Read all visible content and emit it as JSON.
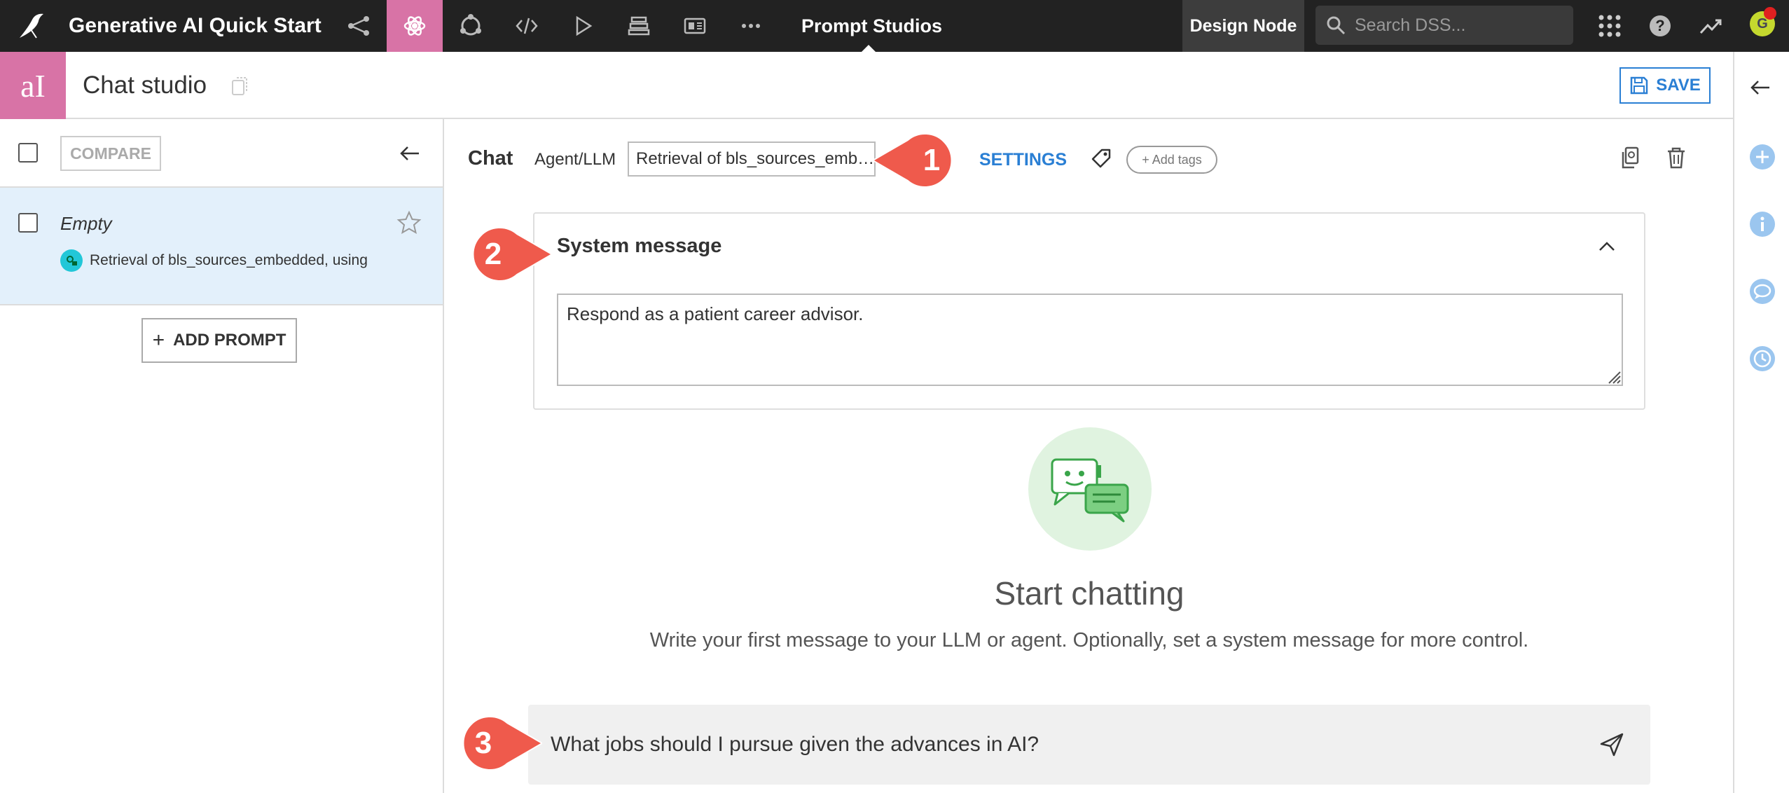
{
  "topnav": {
    "project_title": "Generative AI Quick Start",
    "current_section": "Prompt Studios",
    "design_node": "Design Node",
    "search_placeholder": "Search DSS...",
    "avatar_initial": "G",
    "help_glyph": "?"
  },
  "subheader": {
    "app_badge": "aI",
    "studio_title": "Chat studio",
    "save_label": "SAVE"
  },
  "left_panel": {
    "compare_label": "COMPARE",
    "prompts": [
      {
        "name": "Empty",
        "model": "Retrieval of bls_sources_embedded, using"
      }
    ],
    "add_prompt_label": "ADD PROMPT",
    "add_prompt_glyph": "+"
  },
  "main": {
    "chat_label": "Chat",
    "agent_label": "Agent/LLM",
    "agent_value": "Retrieval of bls_sources_emb…",
    "settings_label": "SETTINGS",
    "add_tags_label": "+ Add tags",
    "system_message": {
      "title": "System message",
      "value": "Respond as a patient career advisor."
    },
    "empty_state": {
      "title": "Start chatting",
      "subtitle": "Write your first message to your LLM or agent. Optionally, set a system message for more control."
    },
    "chat_input_value": "What jobs should I pursue given the advances in AI?"
  },
  "annotations": [
    "1",
    "2",
    "3"
  ],
  "colors": {
    "nav_bg": "#222222",
    "accent_pink": "#d873a6",
    "link_blue": "#2a7fd4",
    "callout_red": "#ef5a4c",
    "selected_row": "#e3f0fb"
  },
  "icons": {
    "nav": [
      "flow-icon",
      "lab-icon",
      "ml-icon",
      "code-icon",
      "run-icon",
      "stack-icon",
      "dashboard-icon",
      "more-icon"
    ],
    "right_rail": [
      "back-arrow-icon",
      "add-icon",
      "info-icon",
      "chat-icon",
      "history-icon"
    ]
  }
}
